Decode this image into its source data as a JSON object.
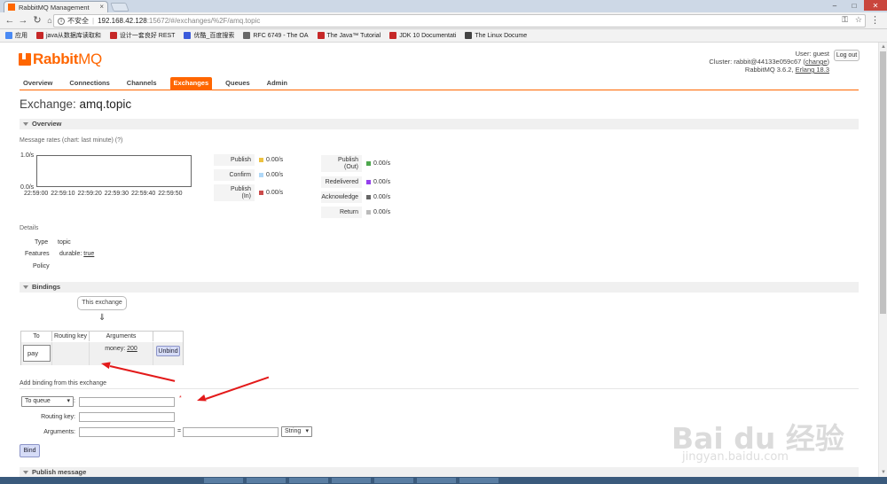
{
  "browser": {
    "tab_title": "RabbitMQ Management",
    "url_security_label": "不安全",
    "url_host": "192.168.42.128",
    "url_path": ":15672/#/exchanges/%2F/amq.topic",
    "bookmarks": [
      {
        "label": "应用",
        "icon_color": "#4a8af4"
      },
      {
        "label": "java从数据库读取和",
        "icon_color": "#c62828"
      },
      {
        "label": "设计一套良好 REST",
        "icon_color": "#c62828"
      },
      {
        "label": "优酷_百度搜索",
        "icon_color": "#3b5bdb"
      },
      {
        "label": "RFC 6749 - The OA",
        "icon_color": "#666666"
      },
      {
        "label": "The Java™ Tutorial",
        "icon_color": "#c62828"
      },
      {
        "label": "JDK 10 Documentati",
        "icon_color": "#c62828"
      },
      {
        "label": "The Linux Docume",
        "icon_color": "#444444"
      }
    ]
  },
  "header": {
    "logo_rabbit": "Rabbit",
    "logo_mq": "MQ",
    "user_line": "User: guest",
    "cluster_prefix": "Cluster: rabbit@44133e059c67 (",
    "cluster_change": "change",
    "cluster_suffix": ")",
    "version_prefix": "RabbitMQ 3.6.2, ",
    "erlang": "Erlang 18.3",
    "logout": "Log out"
  },
  "nav": {
    "tabs": [
      "Overview",
      "Connections",
      "Channels",
      "Exchanges",
      "Queues",
      "Admin"
    ],
    "active": "Exchanges"
  },
  "page": {
    "title_prefix": "Exchange: ",
    "title_name": "amq.topic"
  },
  "overview": {
    "section": "Overview",
    "message_rates_label": "Message rates",
    "message_rates_note": "(chart: last minute) (?)",
    "y_top": "1.0/s",
    "y_bottom": "0.0/s",
    "x_ticks": [
      "22:59:00",
      "22:59:10",
      "22:59:20",
      "22:59:30",
      "22:59:40",
      "22:59:50"
    ],
    "rates_left": [
      {
        "name": "Publish",
        "value": "0.00/s",
        "color": "#edc240"
      },
      {
        "name": "Confirm",
        "value": "0.00/s",
        "color": "#afd8f8"
      },
      {
        "name": "Publish\n(In)",
        "value": "0.00/s",
        "color": "#cb4b4b"
      }
    ],
    "rates_right": [
      {
        "name": "Publish\n(Out)",
        "value": "0.00/s",
        "color": "#4da74d"
      },
      {
        "name": "Redelivered",
        "value": "0.00/s",
        "color": "#9440ed"
      },
      {
        "name": "Acknowledge",
        "value": "0.00/s",
        "color": "#666666"
      },
      {
        "name": "Return",
        "value": "0.00/s",
        "color": "#bbbbbb"
      }
    ]
  },
  "details": {
    "label": "Details",
    "type_label": "Type",
    "type_value": "topic",
    "features_label": "Features",
    "features_key": "durable: ",
    "features_value": "true",
    "policy_label": "Policy"
  },
  "bindings": {
    "section": "Bindings",
    "this_exchange": "This exchange",
    "arrow": "⇓",
    "columns": [
      "To",
      "Routing key",
      "Arguments",
      ""
    ],
    "row": {
      "to": "pay",
      "routing_key": "",
      "arguments_key": "money: ",
      "arguments_value": "200",
      "action": "Unbind"
    }
  },
  "add_binding": {
    "label": "Add binding from this exchange",
    "dest_select": "To queue",
    "colon": ":",
    "required_marker": "*",
    "routing_key_label": "Routing key:",
    "arguments_label": "Arguments:",
    "equals": "=",
    "type_select": "String",
    "bind_button": "Bind"
  },
  "publish": {
    "section": "Publish message"
  },
  "watermark": {
    "logo": "Bai du 经验",
    "url": "jingyan.baidu.com"
  }
}
